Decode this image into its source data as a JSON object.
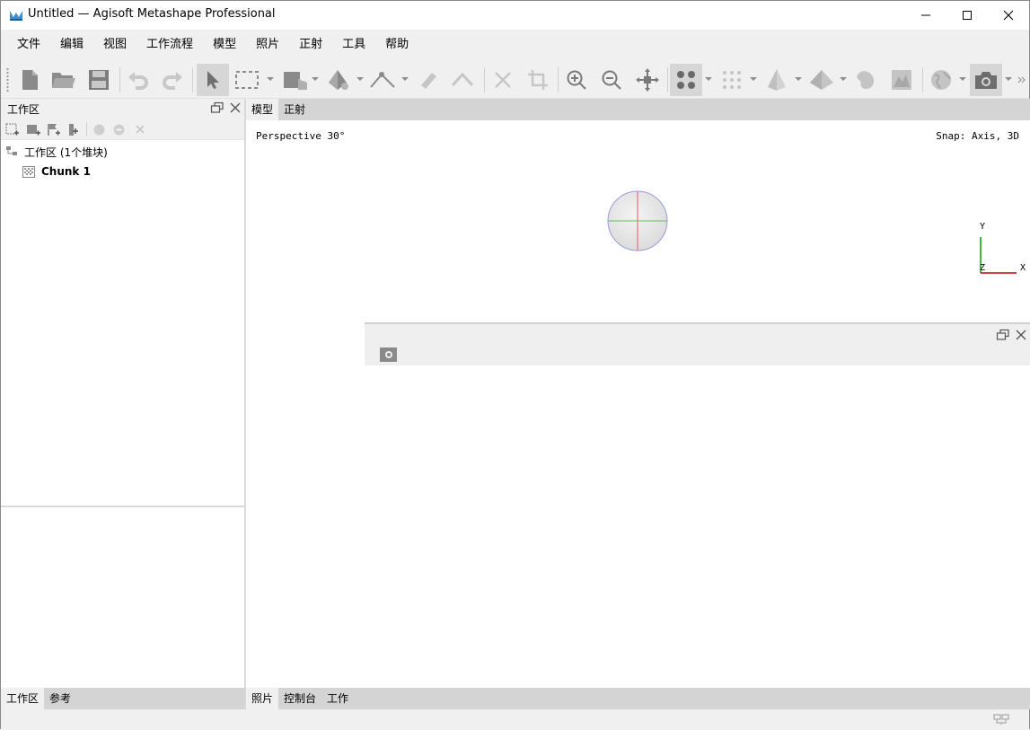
{
  "window": {
    "title": "Untitled — Agisoft Metashape Professional"
  },
  "menu": [
    "文件",
    "编辑",
    "视图",
    "工作流程",
    "模型",
    "照片",
    "正射",
    "工具",
    "帮助"
  ],
  "workspace": {
    "title": "工作区",
    "root_label": "工作区 (1个堆块)",
    "chunk_label": "Chunk 1",
    "tabs": [
      "工作区",
      "参考"
    ]
  },
  "view": {
    "tabs": [
      "模型",
      "正射"
    ],
    "perspective": "Perspective 30°",
    "snap": "Snap: Axis, 3D",
    "axis_x": "X",
    "axis_y": "Y",
    "axis_z": "Z"
  },
  "bottom_tabs": [
    "照片",
    "控制台",
    "工作"
  ],
  "colors": {
    "panel_bg": "#f0f0f0",
    "tab_bar": "#d4d4d4",
    "axis_x": "#c00000",
    "axis_y": "#00a000",
    "axis_z": "#0000c0"
  }
}
